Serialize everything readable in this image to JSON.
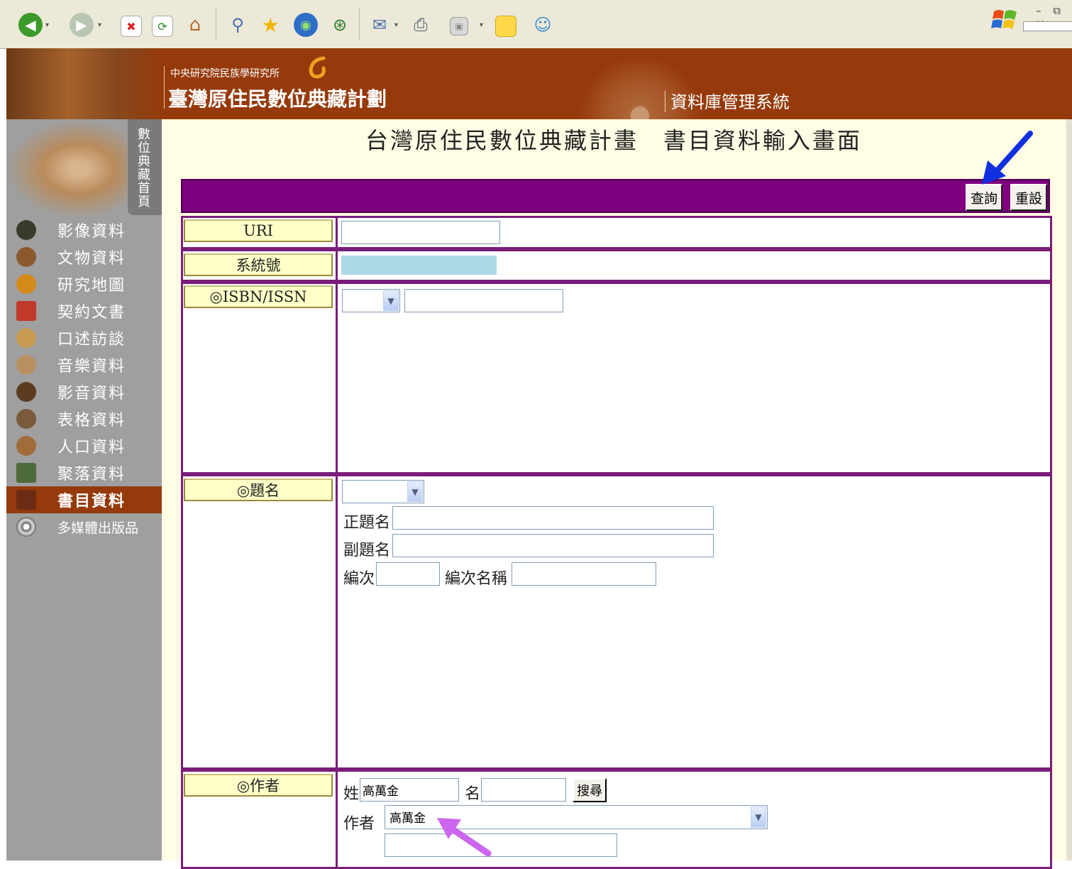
{
  "header": {
    "org_name": "中央研究院民族學研究所",
    "project_title": "臺灣原住民數位典藏計劃",
    "system_name": "資料庫管理系統"
  },
  "sidebar": {
    "home_tab": "數位典藏首頁",
    "items": [
      {
        "label": "影像資料",
        "icon": "pottery-icon",
        "color": "#3a3a2a"
      },
      {
        "label": "文物資料",
        "icon": "artifact-icon",
        "color": "#8a5a2e"
      },
      {
        "label": "研究地圖",
        "icon": "compass-icon",
        "color": "#d58a1c"
      },
      {
        "label": "契約文書",
        "icon": "seal-icon",
        "color": "#c0392b"
      },
      {
        "label": "口述訪談",
        "icon": "shell-icon",
        "color": "#c79a52"
      },
      {
        "label": "音樂資料",
        "icon": "instrument-icon",
        "color": "#b89060"
      },
      {
        "label": "影音資料",
        "icon": "horn-icon",
        "color": "#5c3b20"
      },
      {
        "label": "表格資料",
        "icon": "basket-icon",
        "color": "#7b5a3b"
      },
      {
        "label": "人口資料",
        "icon": "beads-icon",
        "color": "#a06c3a"
      },
      {
        "label": "聚落資料",
        "icon": "totem-icon",
        "color": "#4e6b3c"
      },
      {
        "label": "書目資料",
        "icon": "book-icon",
        "color": "#6b2b14"
      },
      {
        "label": "多媒體出版品",
        "icon": "disc-icon",
        "color": "#666666"
      }
    ],
    "active_index": 10
  },
  "main": {
    "page_title": "台灣原住民數位典藏計畫　書目資料輸入畫面",
    "query_button": "查詢",
    "reset_button": "重設",
    "fields": {
      "uri_label": "URI",
      "uri_value": "",
      "sysno_label": "系統號",
      "isbn_label": "◎ISBN/ISSN",
      "isbn_select": "",
      "isbn_value": "",
      "title_label": "◎題名",
      "title_select": "",
      "main_title_label": "正題名",
      "main_title_value": "",
      "subtitle_label": "副題名",
      "subtitle_value": "",
      "edition_label": "編次",
      "edition_value": "",
      "edition_name_label": "編次名稱",
      "edition_name_value": "",
      "author_label": "◎作者",
      "surname_label": "姓",
      "surname_value": "高萬金",
      "given_name_label": "名",
      "given_name_value": "",
      "search_button": "搜尋",
      "author_select_label": "作者",
      "author_select_value": "高萬金",
      "author_extra_value": ""
    }
  },
  "colors": {
    "banner": "#963a0c",
    "form_header": "#7f007f",
    "label_bg": "#ffffc8",
    "sysno_bg": "#add8e6",
    "blue_arrow": "#1030e0",
    "pink_arrow": "#cc66ee"
  }
}
